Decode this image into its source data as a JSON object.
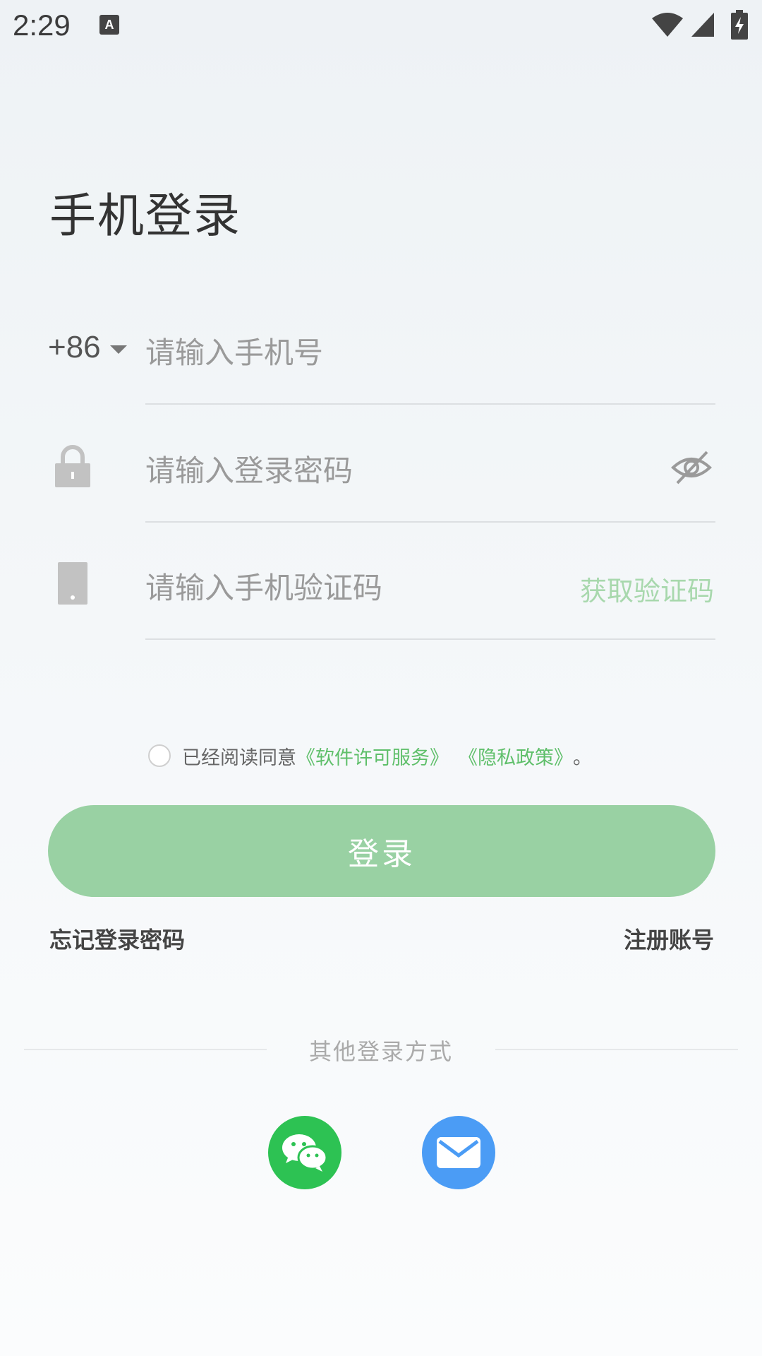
{
  "status_bar": {
    "time": "2:29",
    "icons": [
      "a-notification-icon",
      "wifi-icon",
      "signal-icon",
      "battery-charging-icon"
    ]
  },
  "page": {
    "title": "手机登录"
  },
  "form": {
    "country_code": "+86",
    "phone_placeholder": "请输入手机号",
    "password_placeholder": "请输入登录密码",
    "code_placeholder": "请输入手机验证码",
    "get_code_label": "获取验证码"
  },
  "agreement": {
    "prefix": "已经阅读同意",
    "license_link": "《软件许可服务》",
    "privacy_link": "《隐私政策》",
    "suffix": "。"
  },
  "actions": {
    "login_label": "登录",
    "forgot_label": "忘记登录密码",
    "register_label": "注册账号"
  },
  "other_login": {
    "title": "其他登录方式",
    "methods": [
      "wechat-icon",
      "mail-icon"
    ]
  },
  "colors": {
    "accent_green": "#99d1a3",
    "link_green": "#5fbf6a",
    "wechat_green": "#2dc253",
    "mail_blue": "#4b9cf5"
  }
}
